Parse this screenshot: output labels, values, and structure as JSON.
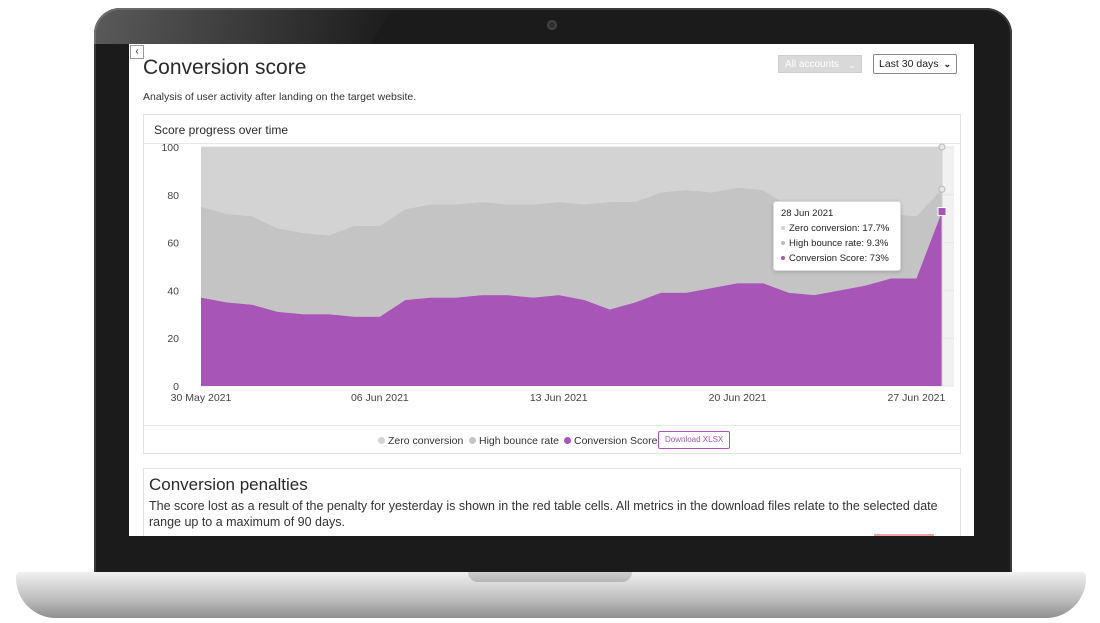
{
  "page": {
    "back_icon_glyph": "‹",
    "title": "Conversion score",
    "subtitle": "Analysis of user activity after landing on the target website.",
    "accounts_select": "All accounts",
    "range_select": "Last 30 days"
  },
  "chart_card": {
    "title": "Score progress over time",
    "download_label": "Download XLSX"
  },
  "tooltip": {
    "date": "28 Jun 2021",
    "rows": [
      {
        "label": "Zero conversion:",
        "value": "17.7%"
      },
      {
        "label": "High bounce rate:",
        "value": "9.3%"
      },
      {
        "label": "Conversion Score:",
        "value": "73%"
      }
    ]
  },
  "legend": [
    {
      "name": "Zero conversion",
      "color": "#d3d3d3"
    },
    {
      "name": "High bounce rate",
      "color": "#c4c4c4"
    },
    {
      "name": "Conversion Score",
      "color": "#a855b8"
    }
  ],
  "chart_data": {
    "type": "area",
    "stacked": true,
    "x_tick_labels": [
      "30 May 2021",
      "06 Jun 2021",
      "13 Jun 2021",
      "20 Jun 2021",
      "27 Jun 2021"
    ],
    "y_ticks": [
      0,
      20,
      40,
      60,
      80,
      100
    ],
    "ylim": [
      0,
      100
    ],
    "x": [
      "30 May 2021",
      "31 May 2021",
      "01 Jun 2021",
      "02 Jun 2021",
      "03 Jun 2021",
      "04 Jun 2021",
      "05 Jun 2021",
      "06 Jun 2021",
      "07 Jun 2021",
      "08 Jun 2021",
      "09 Jun 2021",
      "10 Jun 2021",
      "11 Jun 2021",
      "12 Jun 2021",
      "13 Jun 2021",
      "14 Jun 2021",
      "15 Jun 2021",
      "16 Jun 2021",
      "17 Jun 2021",
      "18 Jun 2021",
      "19 Jun 2021",
      "20 Jun 2021",
      "21 Jun 2021",
      "22 Jun 2021",
      "23 Jun 2021",
      "24 Jun 2021",
      "25 Jun 2021",
      "26 Jun 2021",
      "27 Jun 2021",
      "28 Jun 2021"
    ],
    "series": [
      {
        "name": "Conversion Score",
        "color": "#a855b8",
        "values": [
          37,
          35,
          34,
          31,
          30,
          30,
          29,
          29,
          36,
          37,
          37,
          38,
          38,
          37,
          38,
          36,
          32,
          35,
          39,
          39,
          41,
          43,
          43,
          39,
          38,
          40,
          42,
          45,
          45,
          73
        ]
      },
      {
        "name": "High bounce rate",
        "color": "#c4c4c4",
        "values": [
          38,
          37,
          37,
          35,
          34,
          33,
          38,
          38,
          38,
          39,
          39,
          39,
          38,
          39,
          39,
          40,
          45,
          42,
          42,
          43,
          40,
          40,
          39,
          36,
          31,
          31,
          30,
          27,
          26,
          9.3
        ]
      },
      {
        "name": "Zero conversion",
        "color": "#d3d3d3",
        "values": [
          25,
          28,
          29,
          34,
          36,
          37,
          33,
          33,
          26,
          24,
          24,
          23,
          24,
          24,
          23,
          24,
          23,
          23,
          19,
          18,
          19,
          17,
          18,
          25,
          31,
          29,
          28,
          28,
          29,
          17.7
        ]
      }
    ],
    "grid": true,
    "legend_position": "bottom"
  },
  "penalties": {
    "title": "Conversion penalties",
    "text": "The score lost as a result of the penalty for yesterday is shown in the red table cells. All metrics in the download files relate to the selected date range up to a maximum of 90 days."
  }
}
